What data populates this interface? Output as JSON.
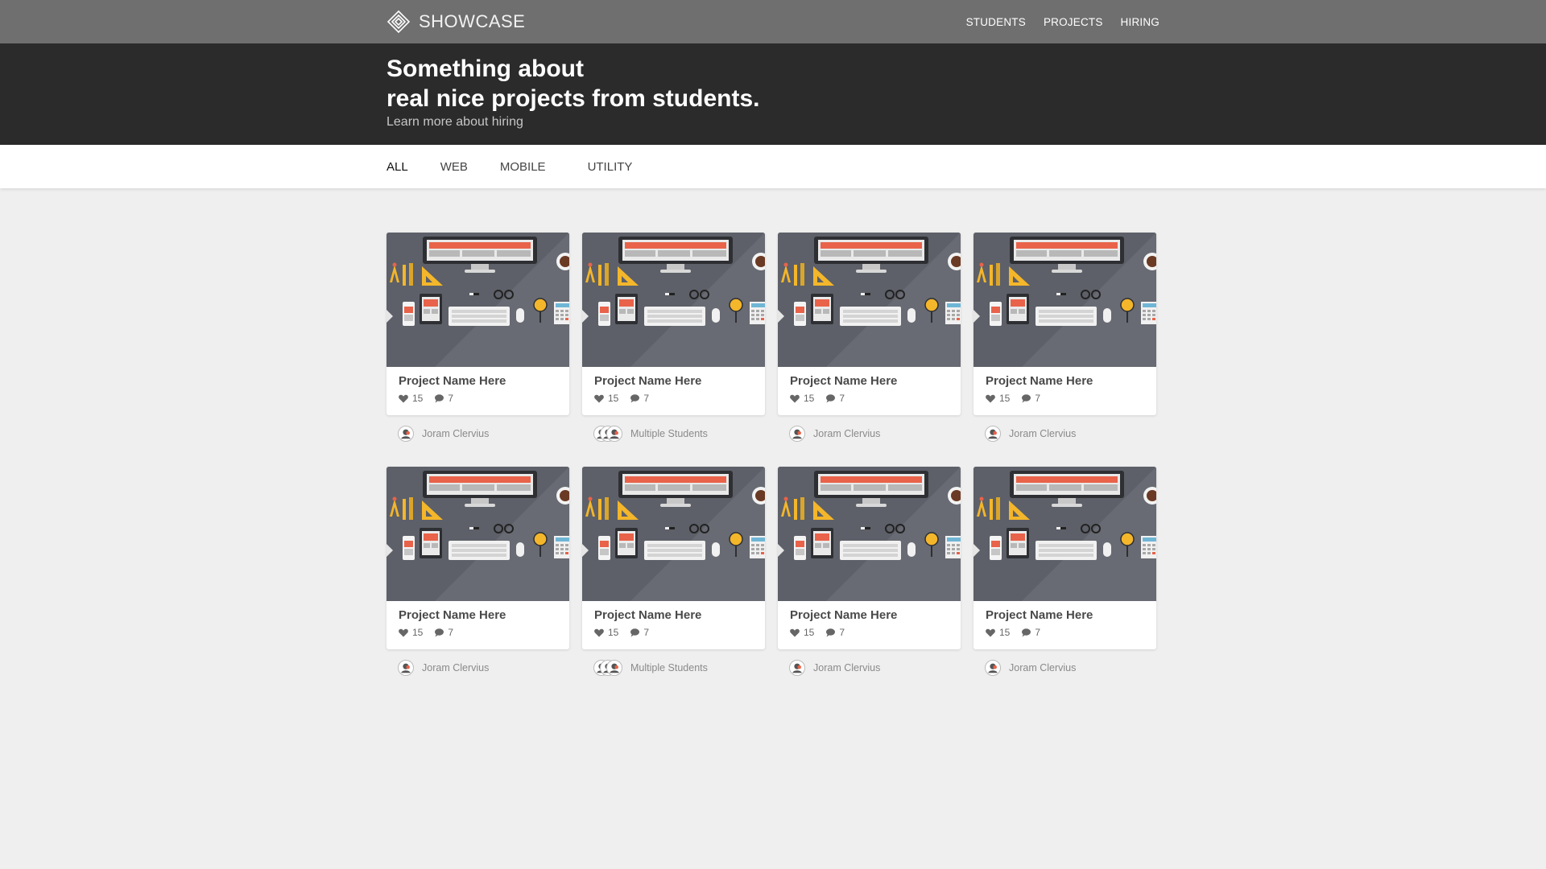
{
  "header": {
    "brand": "SHOWCASE",
    "logo_icon": "diamond-logo-icon",
    "nav": [
      "STUDENTS",
      "PROJECTS",
      "HIRING"
    ]
  },
  "hero": {
    "title_line1": "Something about",
    "title_line2": "real nice projects from students.",
    "link": "Learn more about hiring"
  },
  "filters": {
    "tabs": [
      "ALL",
      "WEB",
      "MOBILE",
      "UTILITY"
    ],
    "active": "ALL"
  },
  "projects": [
    {
      "name": "Project Name Here",
      "likes": "15",
      "comments": "7",
      "author": "Joram Clervius",
      "multiple": false
    },
    {
      "name": "Project Name Here",
      "likes": "15",
      "comments": "7",
      "author": "Multiple Students",
      "multiple": true
    },
    {
      "name": "Project Name Here",
      "likes": "15",
      "comments": "7",
      "author": "Joram Clervius",
      "multiple": false
    },
    {
      "name": "Project Name Here",
      "likes": "15",
      "comments": "7",
      "author": "Joram Clervius",
      "multiple": false
    },
    {
      "name": "Project Name Here",
      "likes": "15",
      "comments": "7",
      "author": "Joram Clervius",
      "multiple": false
    },
    {
      "name": "Project Name Here",
      "likes": "15",
      "comments": "7",
      "author": "Multiple Students",
      "multiple": true
    },
    {
      "name": "Project Name Here",
      "likes": "15",
      "comments": "7",
      "author": "Joram Clervius",
      "multiple": false
    },
    {
      "name": "Project Name Here",
      "likes": "15",
      "comments": "7",
      "author": "Joram Clervius",
      "multiple": false
    }
  ],
  "colors": {
    "topbar": "#6f6f6f",
    "hero": "#2b2b2b",
    "page_bg": "#efefef",
    "thumb_bg": "#5d6068",
    "accent": "#e8634a"
  }
}
